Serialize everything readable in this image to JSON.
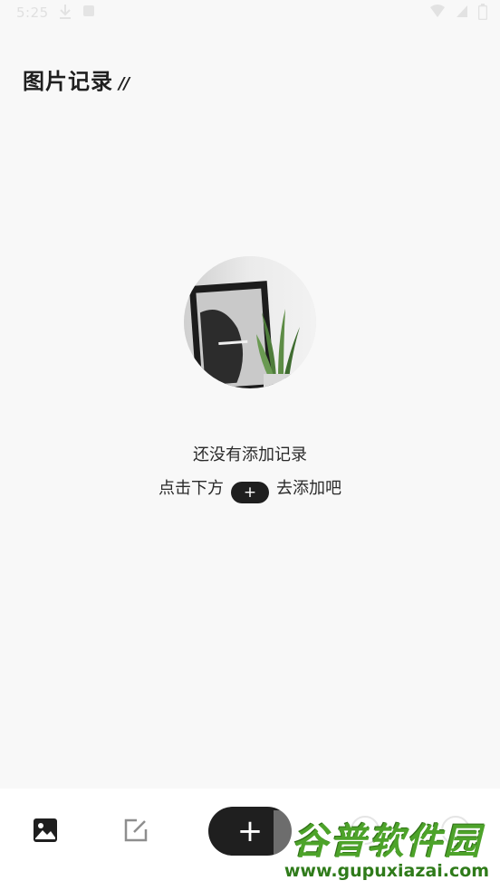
{
  "status_bar": {
    "time": "5:25",
    "download_icon": "download-icon",
    "notification_icon": "notification-icon",
    "wifi_icon": "wifi-icon",
    "signal_icon": "signal-icon",
    "battery_icon": "battery-icon"
  },
  "header": {
    "title": "图片记录",
    "decoration": "//"
  },
  "empty_state": {
    "illustration": "framed-poster-with-plant",
    "title": "还没有添加记录",
    "hint_before": "点击下方",
    "hint_plus": "+",
    "hint_after": "去添加吧"
  },
  "tab_bar": {
    "items": [
      {
        "icon": "gallery-icon",
        "active": true
      },
      {
        "icon": "edit-icon",
        "active": false
      }
    ],
    "fab_label": "+"
  },
  "watermark": {
    "title": "谷普软件园",
    "url": "www.gupuxiazai.com"
  },
  "colors": {
    "background": "#f8f8f8",
    "primary_dark": "#1f1f1f",
    "watermark_green": "#4da32a"
  }
}
